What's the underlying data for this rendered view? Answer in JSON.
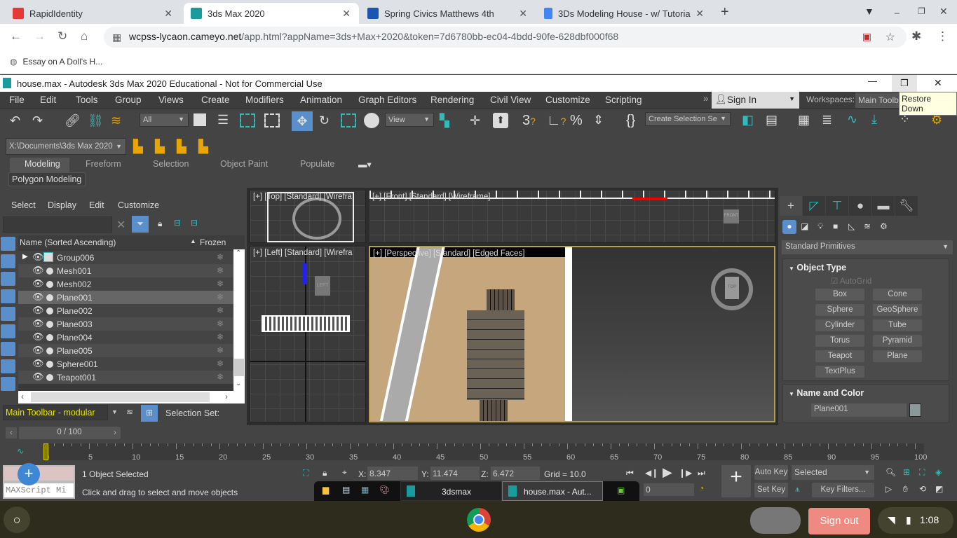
{
  "browser": {
    "tabs": [
      {
        "title": "RapidIdentity",
        "color": "#e53935"
      },
      {
        "title": "3ds Max 2020",
        "color": "#1a9c9c",
        "active": true
      },
      {
        "title": "Spring Civics Matthews 4th",
        "color": "#1a56b0"
      },
      {
        "title": "3Ds Modeling House - w/ Tutoria",
        "color": "#4285f4"
      }
    ],
    "url_host": "wcpss-lycaon.cameyo.net",
    "url_path": "/app.html?appName=3ds+Max+2020&token=7d6780bb-ec04-4bdd-90fe-628dbf000f68",
    "bookmark": "Essay on A Doll's H..."
  },
  "app": {
    "title": "house.max - Autodesk 3ds Max 2020 Educational - Not for Commercial Use",
    "tooltip": "Restore Down",
    "menu": [
      "File",
      "Edit",
      "Tools",
      "Group",
      "Views",
      "Create",
      "Modifiers",
      "Animation",
      "Graph Editors",
      "Rendering",
      "Civil View",
      "Customize",
      "Scripting"
    ],
    "sign_in": "Sign In",
    "workspaces_label": "Workspaces:",
    "workspace": "Main Toolba",
    "selection_filter": "All",
    "ref_coord": "View",
    "selection_set": "Create Selection Se",
    "project_path": "X:\\Documents\\3ds Max 2020",
    "ribbon_tabs": [
      "Modeling",
      "Freeform",
      "Selection",
      "Object Paint",
      "Populate"
    ],
    "ribbon_panel": "Polygon Modeling"
  },
  "explorer": {
    "menu": [
      "Select",
      "Display",
      "Edit",
      "Customize"
    ],
    "search_placeholder": "",
    "col_name": "Name (Sorted Ascending)",
    "col_frozen": "Frozen",
    "rows": [
      "Group006",
      "Mesh001",
      "Mesh002",
      "Plane001",
      "Plane002",
      "Plane003",
      "Plane004",
      "Plane005",
      "Sphere001",
      "Teapot001"
    ],
    "selected": "Plane001",
    "toolbar_name": "Main Toolbar - modular",
    "selection_set_label": "Selection Set:"
  },
  "viewports": {
    "top": "[+] [Top] [Standard] [Wirefra",
    "front": "[+] [Front] [Standard] [Wireframe]",
    "left": "[+] [Left] [Standard] [Wirefra",
    "perspective": "[+] [Perspective] [Standard] [Edged Faces]",
    "cube_top": "TOP",
    "cube_front": "FRONT",
    "cube_left": "LEFT"
  },
  "command_panel": {
    "category": "Standard Primitives",
    "object_type": "Object Type",
    "autogrid": "AutoGrid",
    "buttons": [
      "Box",
      "Cone",
      "Sphere",
      "GeoSphere",
      "Cylinder",
      "Tube",
      "Torus",
      "Pyramid",
      "Teapot",
      "Plane",
      "TextPlus"
    ],
    "name_and_color": "Name and Color",
    "object_name": "Plane001",
    "object_color": "#8a9a9a"
  },
  "timeline": {
    "frame": "0 / 100",
    "ticks": [
      "0",
      "5",
      "10",
      "15",
      "20",
      "25",
      "30",
      "35",
      "40",
      "45",
      "50",
      "55",
      "60",
      "65",
      "70",
      "75",
      "80",
      "85",
      "90",
      "95",
      "100"
    ],
    "progress": 0
  },
  "status": {
    "maxscript": "MAXScript Mi",
    "selected": "1 Object Selected",
    "prompt": "Click and drag to select and move objects",
    "x_label": "X:",
    "x": "8.347",
    "y_label": "Y:",
    "y": "11.474",
    "z_label": "Z:",
    "z": "6.472",
    "grid": "Grid = 10.0",
    "auto_key": "Auto Key",
    "set_key": "Set Key",
    "key_mode": "Selected",
    "key_filters": "Key Filters...",
    "current_frame": "0"
  },
  "win_taskbar": {
    "app1": "3dsmax",
    "app2": "house.max - Aut..."
  },
  "shelf": {
    "sign_out": "Sign out",
    "time": "1:08"
  }
}
